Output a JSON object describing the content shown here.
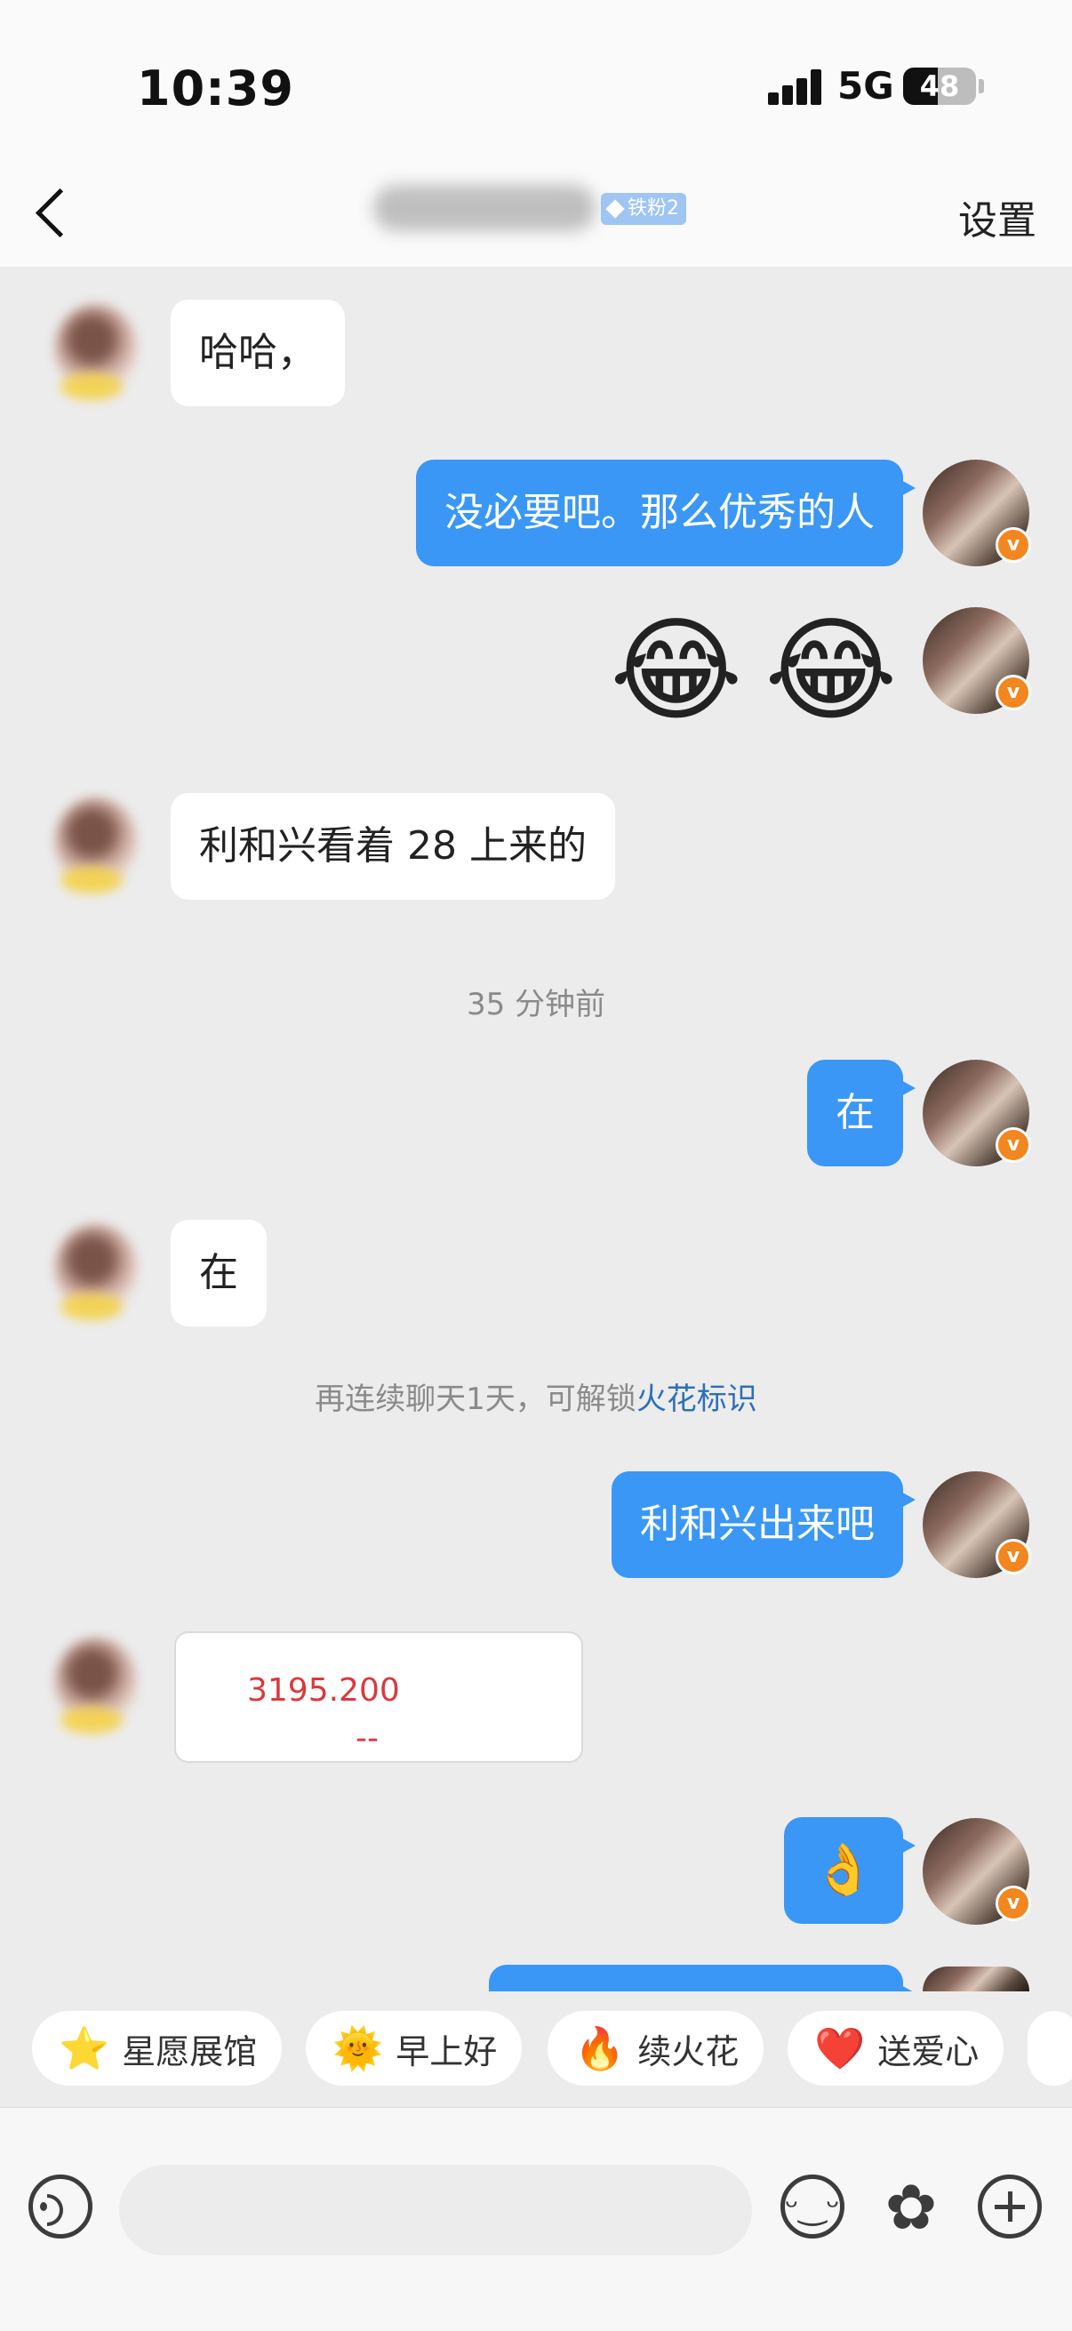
{
  "status_bar": {
    "time": "10:39",
    "network": "5G",
    "battery": "48",
    "battery_level": 0.48
  },
  "header": {
    "fan_badge": "铁粉2",
    "settings": "设置"
  },
  "messages": {
    "m1": "哈哈，",
    "m2": "没必要吧。那么优秀的人",
    "m3_emoji": [
      "😂",
      "😂"
    ],
    "m4": "利和兴看着 28 上来的",
    "time_sep": "35 分钟前",
    "m5": "在",
    "m6": "在",
    "streak_text": "再连续聊天1天，可解锁",
    "streak_link": "火花标识",
    "m7": "利和兴出来吧",
    "m8_image_value": "3195.200",
    "m8_image_dash": "--",
    "m9_emoji": "👌"
  },
  "quick_actions": [
    {
      "icon": "⭐",
      "label": "星愿展馆"
    },
    {
      "icon": "🌞",
      "label": "早上好"
    },
    {
      "icon": "🔥",
      "label": "续火花"
    },
    {
      "icon": "❤️",
      "label": "送爱心"
    }
  ],
  "input": {
    "placeholder": ""
  },
  "colors": {
    "accent_blue": "#3a97f5",
    "background": "#ececec",
    "link": "#2f6fb8"
  }
}
